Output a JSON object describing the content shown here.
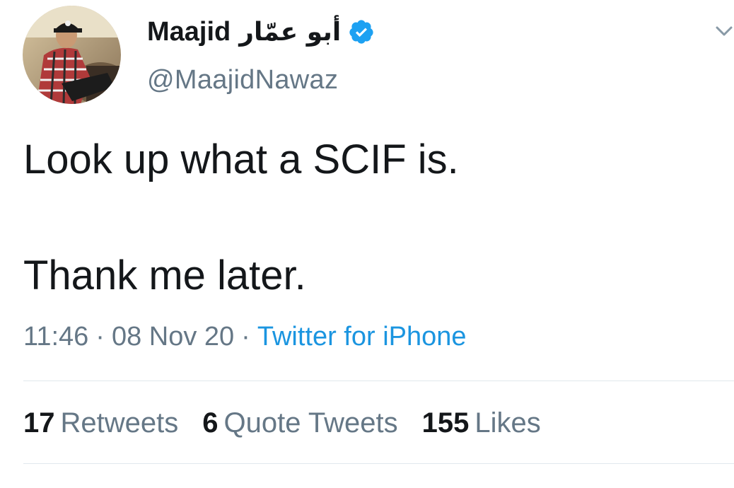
{
  "author": {
    "display_name": "Maajid",
    "display_name_arabic": "أبو عمّار",
    "handle": "@MaajidNawaz",
    "verified": true,
    "avatar_icon": "profile-photo"
  },
  "tweet": {
    "line1": "Look up what a SCIF is.",
    "line2": "Thank me later."
  },
  "meta": {
    "time": "11:46",
    "date": "08 Nov 20",
    "separator": "·",
    "source": "Twitter for iPhone"
  },
  "stats": {
    "retweets_count": "17",
    "retweets_label": "Retweets",
    "quotes_count": "6",
    "quotes_label": "Quote Tweets",
    "likes_count": "155",
    "likes_label": "Likes"
  },
  "colors": {
    "text_primary": "#14171a",
    "text_secondary": "#657786",
    "accent": "#1b95e0",
    "verified": "#1da1f2",
    "divider": "#e1e8ed"
  },
  "icons": {
    "verified": "verified-badge-icon",
    "menu": "chevron-down-icon"
  }
}
